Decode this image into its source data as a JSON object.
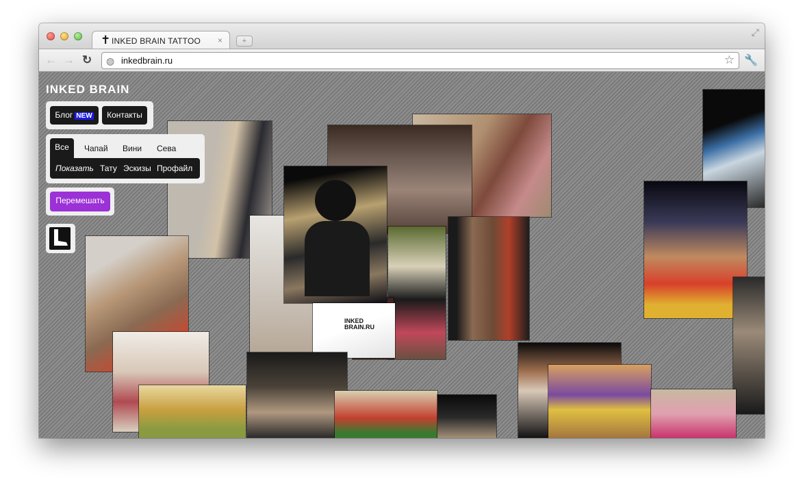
{
  "browser": {
    "tab_title": "INKED BRAIN TATTOO",
    "tab_close": "×",
    "new_tab": "+",
    "url": "inkedbrain.ru"
  },
  "site": {
    "logo": "INKED BRAIN",
    "nav": {
      "blog": "Блог",
      "new_badge": "NEW",
      "contacts": "Контакты"
    },
    "filters": {
      "artists": [
        "Все",
        "Чапай",
        "Вини",
        "Сева"
      ],
      "show_label": "Показать",
      "types": [
        "Тату",
        "Эскизы",
        "Профайл"
      ]
    },
    "shuffle": "Перемешать",
    "watermark": "INKED BRAIN.RU",
    "colors": {
      "accent": "#9b31d6",
      "new_badge_bg": "#1d1ae0",
      "background": "#8c8c8c"
    }
  },
  "icons": {
    "tab_favicon": "cross-icon",
    "back": "back-arrow-icon",
    "forward": "forward-arrow-icon",
    "reload": "reload-icon",
    "site": "globe-icon",
    "bookmark": "star-icon",
    "menu": "wrench-icon",
    "fullscreen": "fullscreen-icon",
    "profile": "foot-icon"
  }
}
